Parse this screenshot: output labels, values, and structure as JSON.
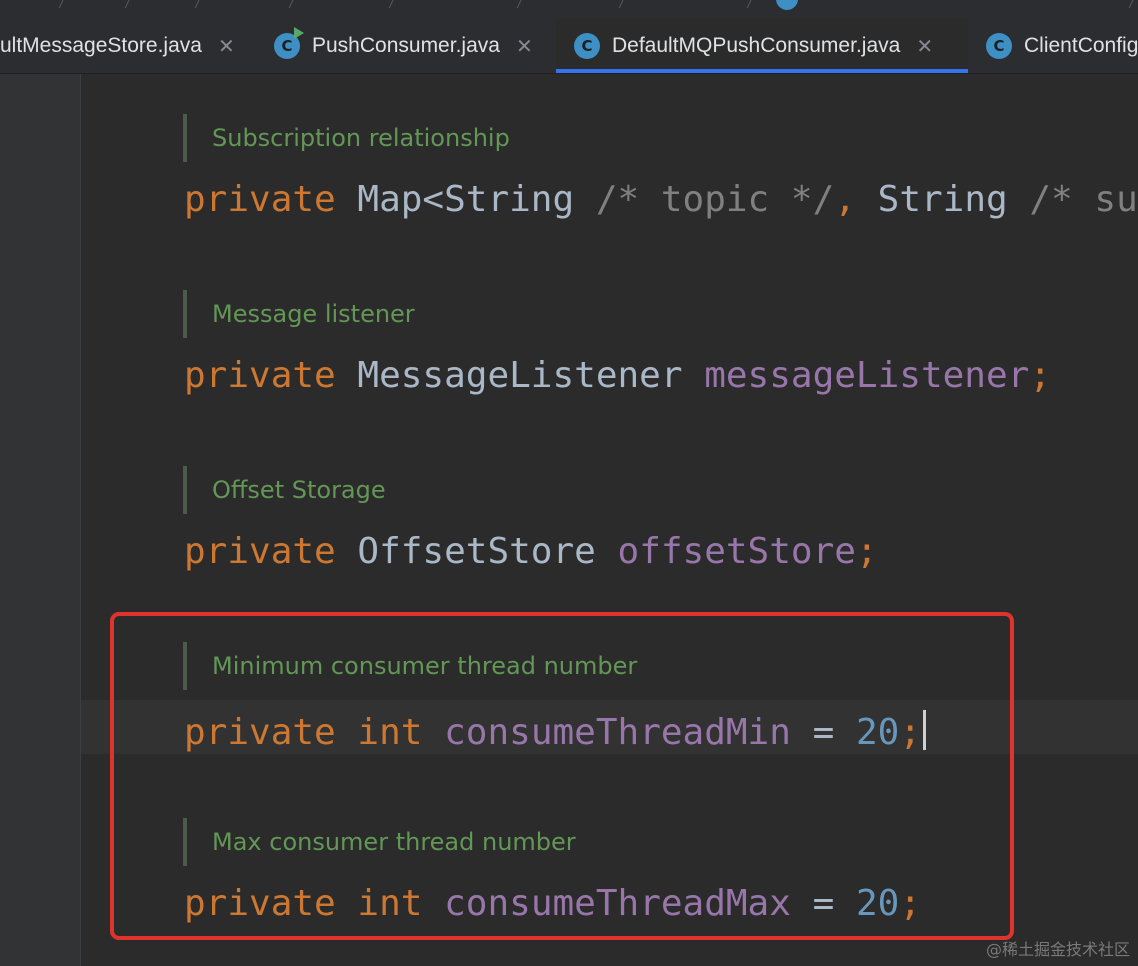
{
  "colors": {
    "keyword": "#cc7832",
    "field": "#9876aa",
    "number": "#6897bb",
    "comment": "#808080",
    "doc_comment": "#629755",
    "plain": "#a9b7c6",
    "highlight_border": "#e0332c",
    "active_tab_underline": "#3574f0"
  },
  "tabs": [
    {
      "label": "ultMessageStore.java",
      "icon": "java-class-icon",
      "active": false
    },
    {
      "label": "PushConsumer.java",
      "icon": "java-interface-run-icon",
      "active": false
    },
    {
      "label": "DefaultMQPushConsumer.java",
      "icon": "java-class-icon",
      "active": true
    },
    {
      "label": "ClientConfig",
      "icon": "java-class-icon",
      "active": false
    }
  ],
  "tab_icon_letter": "C",
  "close_glyph": "✕",
  "code": {
    "subscription": {
      "doc": "Subscription relationship",
      "kw": "private",
      "type": "Map<String",
      "comment1": "/* topic */",
      "comma": ",",
      "type2": "String",
      "comment2": "/* su"
    },
    "listener": {
      "doc": "Message listener",
      "kw": "private",
      "type": "MessageListener",
      "field": "messageListener",
      "semi": ";"
    },
    "offset": {
      "doc": "Offset Storage",
      "kw": "private",
      "type": "OffsetStore",
      "field": "offsetStore",
      "semi": ";"
    },
    "thread_min": {
      "doc": "Minimum consumer thread number",
      "kw": "private",
      "type": "int",
      "field": "consumeThreadMin",
      "op": "=",
      "value": "20",
      "semi": ";"
    },
    "thread_max": {
      "doc": "Max consumer thread number",
      "kw": "private",
      "type": "int",
      "field": "consumeThreadMax",
      "op": "=",
      "value": "20",
      "semi": ";"
    }
  },
  "watermark": "@稀土掘金技术社区"
}
